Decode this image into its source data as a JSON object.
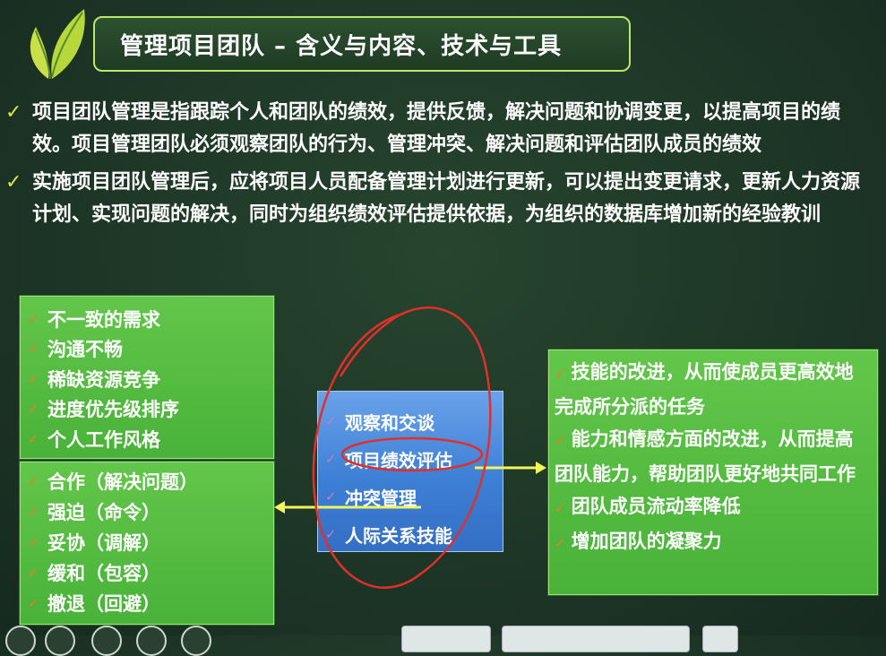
{
  "slide": {
    "title": "管理项目团队 – 含义与内容、技术与工具",
    "bullets": [
      "项目团队管理是指跟踪个人和团队的绩效，提供反馈，解决问题和协调变更，以提高项目的绩效。项目管理团队必须观察团队的行为、管理冲突、解决问题和评估团队成员的绩效",
      "实施项目团队管理后，应将项目人员配备管理计划进行更新，可以提出变更请求，更新人力资源计划、实现问题的解决，同时为组织绩效评估提供依据，为组织的数据库增加新的经验教训"
    ],
    "conflict_sources": [
      "不一致的需求",
      "沟通不畅",
      "稀缺资源竞争",
      "进度优先级排序",
      "个人工作风格"
    ],
    "conflict_resolution": [
      "合作（解决问题）",
      "强迫（命令）",
      "妥协（调解）",
      "缓和（包容）",
      "撤退（回避）"
    ],
    "tools": [
      "观察和交谈",
      "项目绩效评估",
      "冲突管理",
      "人际关系技能"
    ],
    "outcomes": [
      "技能的改进，从而使成员更高效地完成所分派的任务",
      "能力和情感方面的改进，从而提高团队能力，帮助团队更好地共同工作",
      "团队成员流动率降低",
      "增加团队的凝聚力"
    ]
  },
  "colors": {
    "background": "#1f3a2a",
    "check_mark": "#d6e84a",
    "green_box": "#55bb42",
    "blue_box": "#3d7fd6",
    "annotation": "#e0302a",
    "arrow": "#f2f55a"
  },
  "icons": [
    "leaf-logo-icon",
    "check-icon",
    "arrow-icon"
  ]
}
